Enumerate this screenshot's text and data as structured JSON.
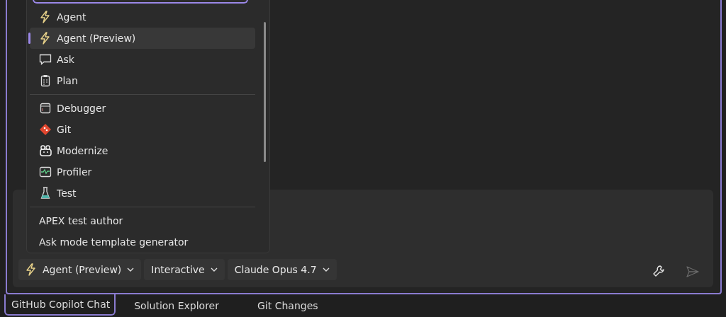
{
  "mode_menu": {
    "groups": [
      {
        "items": [
          {
            "label": "Agent",
            "selected": false
          },
          {
            "label": "Agent (Preview)",
            "selected": true
          },
          {
            "label": "Ask",
            "selected": false
          },
          {
            "label": "Plan",
            "selected": false
          }
        ]
      },
      {
        "items": [
          {
            "label": "Debugger",
            "selected": false
          },
          {
            "label": "Git",
            "selected": false
          },
          {
            "label": "Modernize",
            "selected": false
          },
          {
            "label": "Profiler",
            "selected": false
          },
          {
            "label": "Test",
            "selected": false
          }
        ]
      },
      {
        "items": [
          {
            "label": "APEX test author",
            "selected": false
          },
          {
            "label": "Ask mode template generator",
            "selected": false
          }
        ]
      }
    ]
  },
  "chat_toolbar": {
    "dropdowns": [
      {
        "label": "Agent (Preview)",
        "kind": "mode"
      },
      {
        "label": "Interactive",
        "kind": "plain"
      },
      {
        "label": "Claude Opus 4.7",
        "kind": "plain"
      }
    ]
  },
  "tabs": [
    {
      "label": "GitHub Copilot Chat",
      "selected": true
    },
    {
      "label": "Solution Explorer",
      "selected": false
    },
    {
      "label": "Git Changes",
      "selected": false
    }
  ]
}
